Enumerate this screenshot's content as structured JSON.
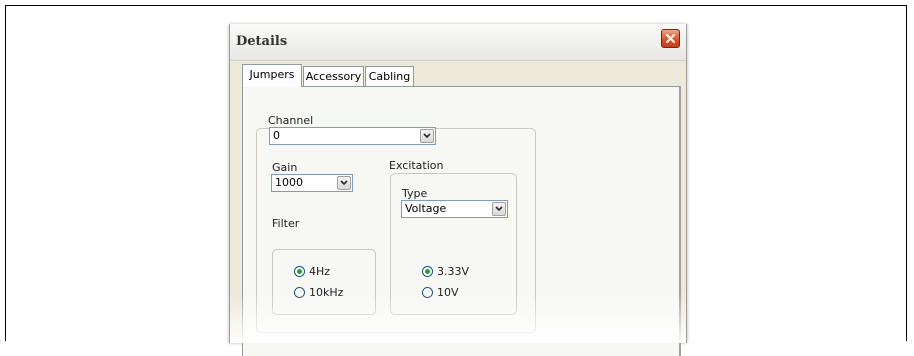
{
  "window": {
    "title": "Details"
  },
  "tabs": [
    {
      "label": "Jumpers",
      "active": true
    },
    {
      "label": "Accessory",
      "active": false
    },
    {
      "label": "Cabling",
      "active": false
    }
  ],
  "channel": {
    "label": "Channel",
    "value": "0"
  },
  "gain": {
    "label": "Gain",
    "value": "1000"
  },
  "filter": {
    "label": "Filter",
    "options": [
      {
        "label": "4Hz",
        "checked": true
      },
      {
        "label": "10kHz",
        "checked": false
      }
    ]
  },
  "excitation": {
    "label": "Excitation",
    "type_label": "Type",
    "type_value": "Voltage",
    "options": [
      {
        "label": "3.33V",
        "checked": true
      },
      {
        "label": "10V",
        "checked": false
      }
    ]
  },
  "colors": {
    "close_button": "#d9542c",
    "radio_dot": "#21a121",
    "border": "#919b9c"
  },
  "icons": {
    "close": "close-icon",
    "dropdown": "chevron-down-icon"
  }
}
